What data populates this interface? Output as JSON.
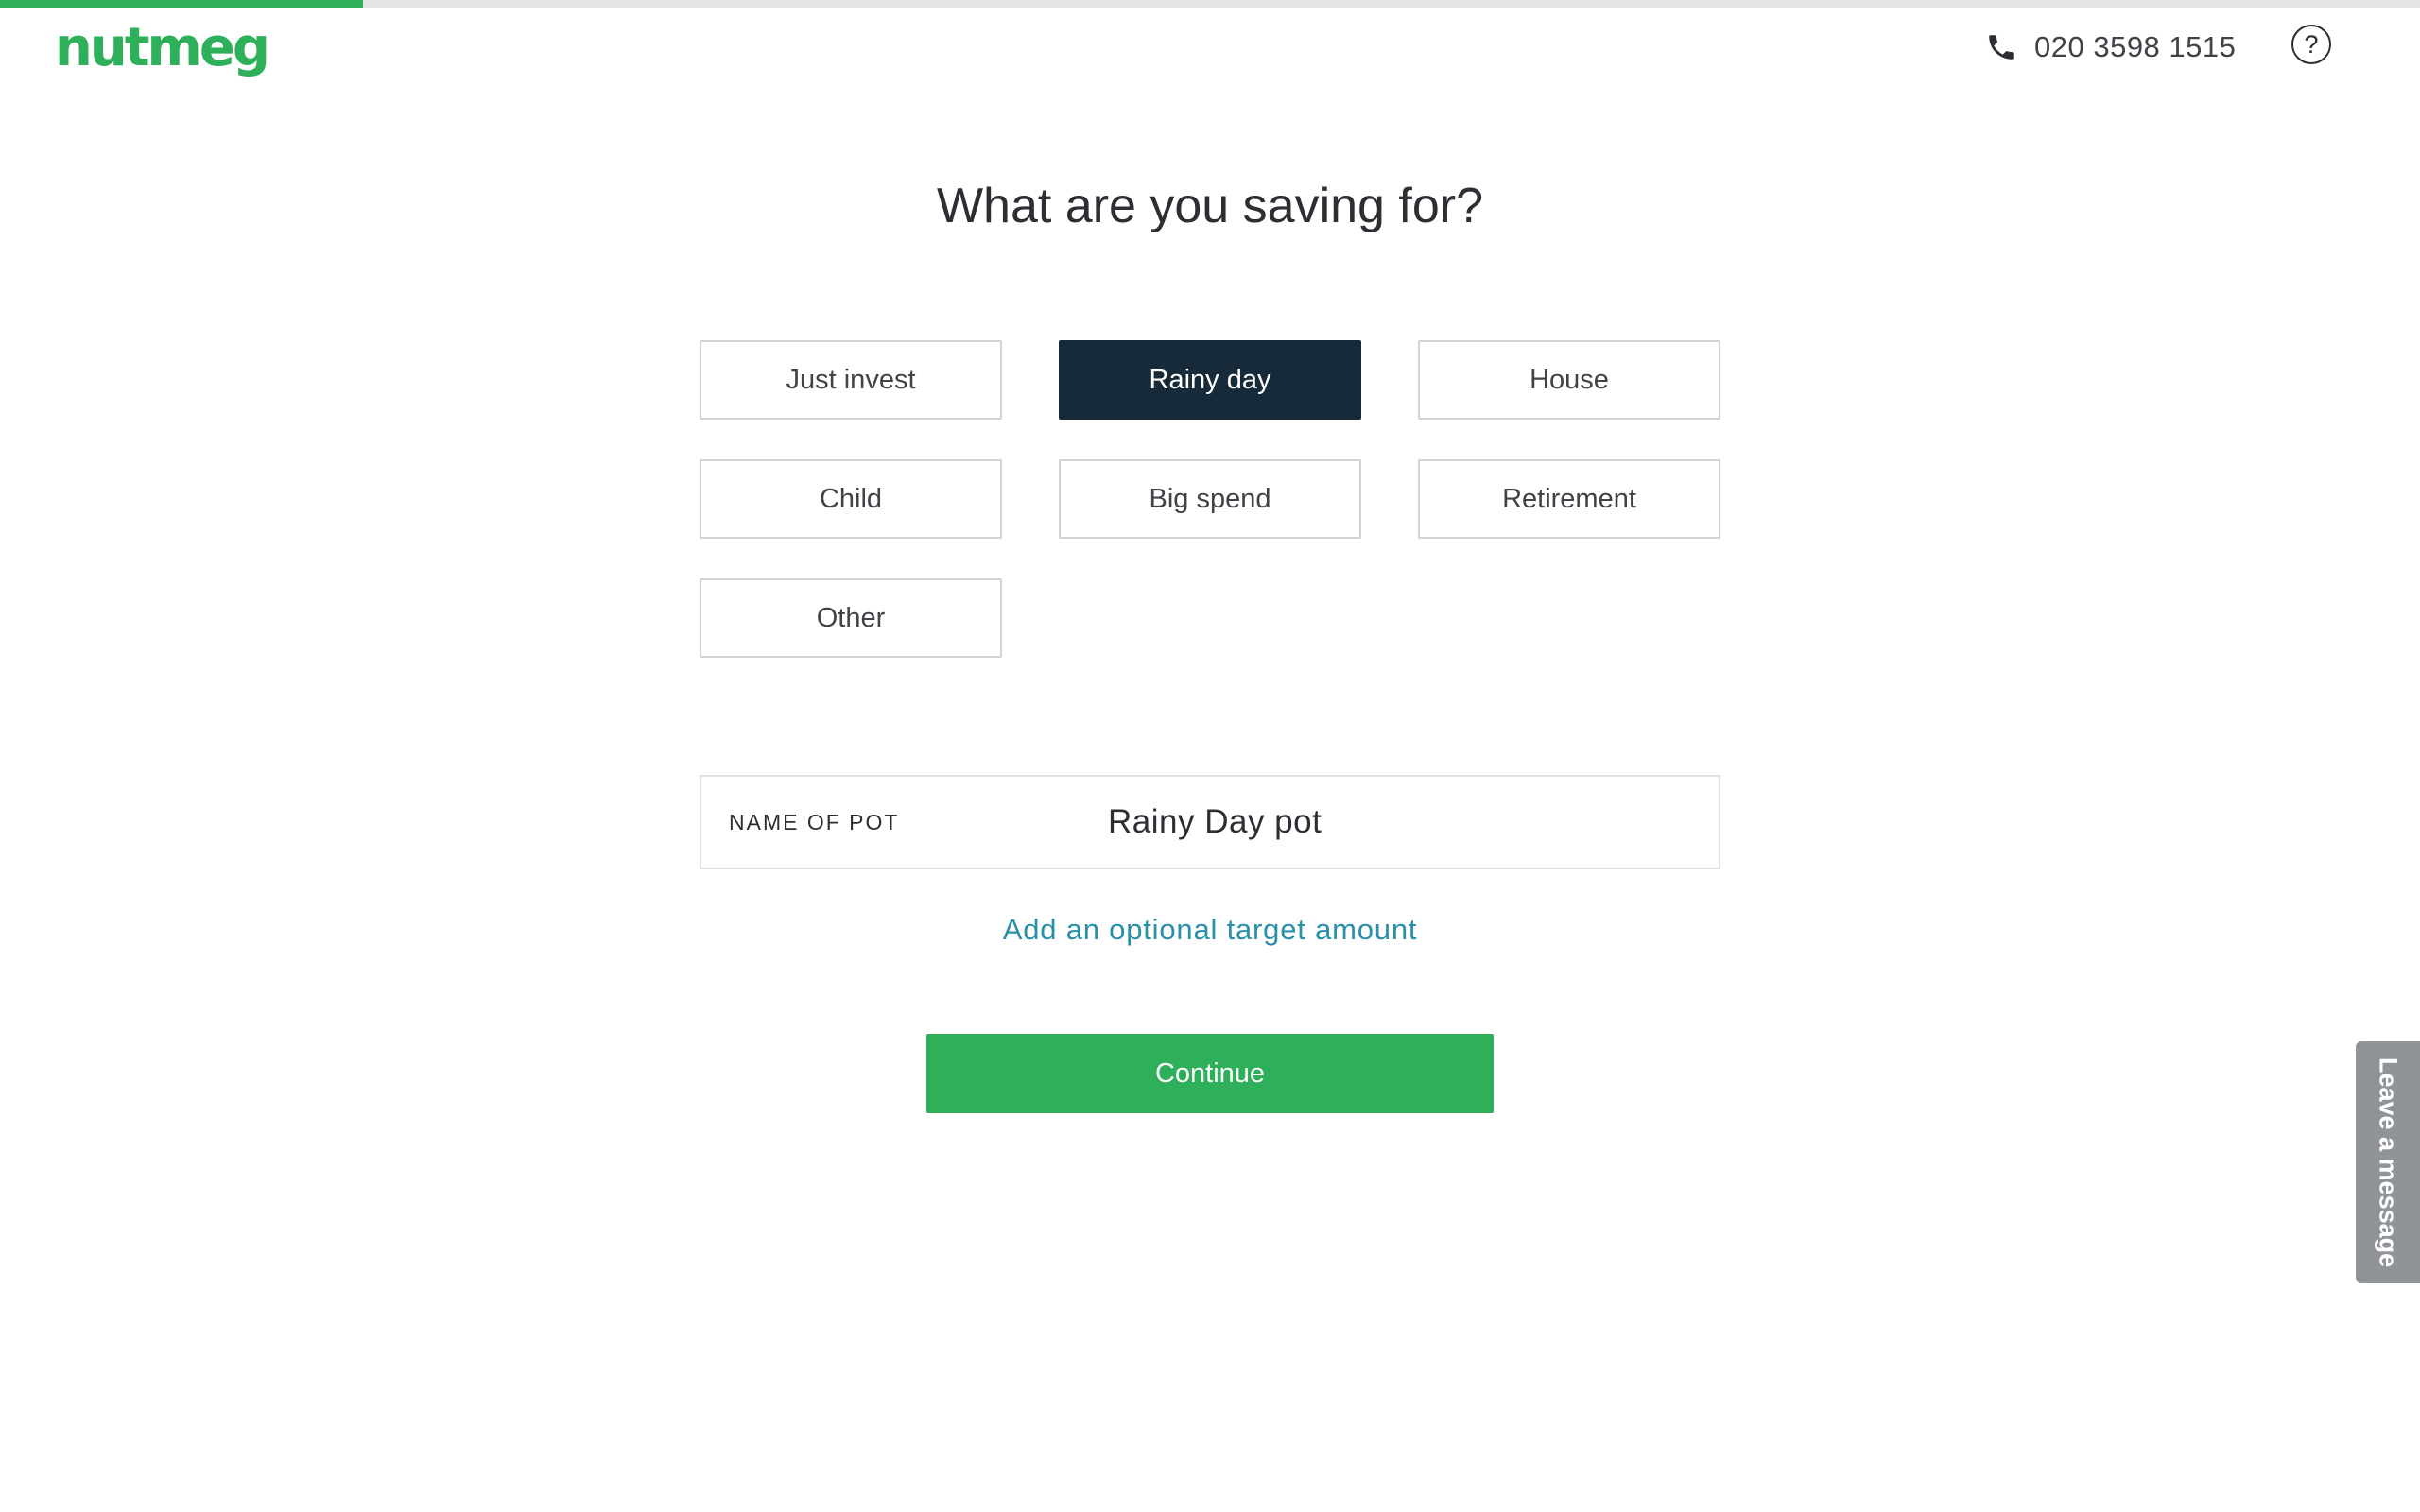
{
  "brand": {
    "logo_text": "nutmeg",
    "accent_color": "#2eb05a",
    "selected_color": "#172a3a",
    "link_color": "#2a8fa8"
  },
  "progress": {
    "fraction": 0.15
  },
  "header": {
    "phone_number": "020 3598 1515",
    "phone_icon": "phone-icon",
    "help_icon": "question-circle-icon",
    "help_symbol": "?"
  },
  "main": {
    "title": "What are you saving for?",
    "goals": [
      {
        "label": "Just invest",
        "selected": false
      },
      {
        "label": "Rainy day",
        "selected": true
      },
      {
        "label": "House",
        "selected": false
      },
      {
        "label": "Child",
        "selected": false
      },
      {
        "label": "Big spend",
        "selected": false
      },
      {
        "label": "Retirement",
        "selected": false
      },
      {
        "label": "Other",
        "selected": false
      }
    ],
    "pot_name": {
      "label": "NAME OF POT",
      "value": "Rainy Day pot"
    },
    "target_link": "Add an optional target amount",
    "continue_label": "Continue"
  },
  "chat_tab": {
    "label": "Leave a message"
  }
}
